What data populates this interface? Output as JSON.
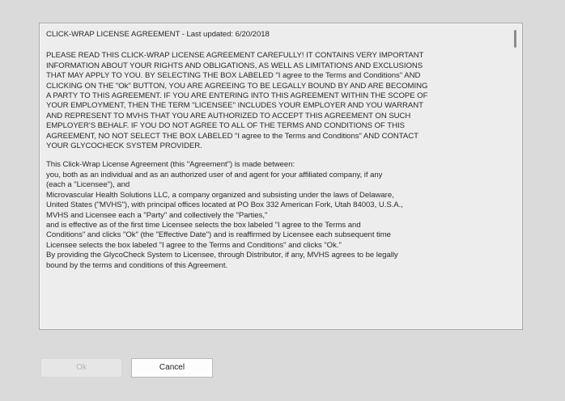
{
  "license": {
    "title": "CLICK-WRAP LICENSE AGREEMENT - Last updated: 6/20/2018",
    "paragraphs": [
      "PLEASE READ THIS CLICK-WRAP LICENSE AGREEMENT CAREFULLY! IT CONTAINS VERY IMPORTANT\nINFORMATION ABOUT YOUR RIGHTS AND OBLIGATIONS, AS WELL AS LIMITATIONS AND EXCLUSIONS\nTHAT MAY APPLY TO YOU. BY SELECTING THE BOX LABELED \"I agree to the Terms and Conditions\" AND\nCLICKING ON THE \"Ok\" BUTTON, YOU ARE AGREEING TO BE LEGALLY BOUND BY AND ARE BECOMING\nA PARTY TO THIS AGREEMENT. IF YOU ARE ENTERING INTO THIS AGREEMENT WITHIN THE SCOPE OF\nYOUR EMPLOYMENT, THEN THE TERM \"LICENSEE\" INCLUDES YOUR EMPLOYER AND YOU WARRANT\nAND REPRESENT TO MVHS THAT YOU ARE AUTHORIZED TO ACCEPT THIS AGREEMENT ON SUCH\nEMPLOYER'S BEHALF. IF YOU DO NOT AGREE TO ALL OF THE TERMS AND CONDITIONS OF THIS\nAGREEMENT, NO NOT SELECT THE BOX LABELED \"I agree to the Terms and Conditions\" AND CONTACT\nYOUR GLYCOCHECK SYSTEM PROVIDER.",
      "This Click-Wrap License Agreement (this \"Agreement\") is made between:\nyou, both as an individual and as an authorized user of and agent for your affiliated company, if any\n(each a \"Licensee\"), and\nMicrovascular Health Solutions LLC, a company organized and subsisting under the laws of Delaware,\nUnited States (\"MVHS\"), with principal offices located at PO Box 332 American Fork, Utah 84003, U.S.A.,\nMVHS and Licensee each a \"Party\" and collectively the \"Parties,\"\nand is effective as of the first time Licensee selects the box labeled \"I agree to the Terms and\nConditions\" and clicks \"Ok\" (the \"Effective Date\") and is reaffirmed by Licensee each subsequent time\nLicensee selects the box labeled \"I agree to the Terms and Conditions\" and clicks \"Ok.\"\nBy providing the GlycoCheck System to Licensee, through Distributor, if any, MVHS agrees to be legally\nbound by the terms and conditions of this Agreement."
    ]
  },
  "buttons": {
    "ok_label": "Ok",
    "cancel_label": "Cancel"
  }
}
